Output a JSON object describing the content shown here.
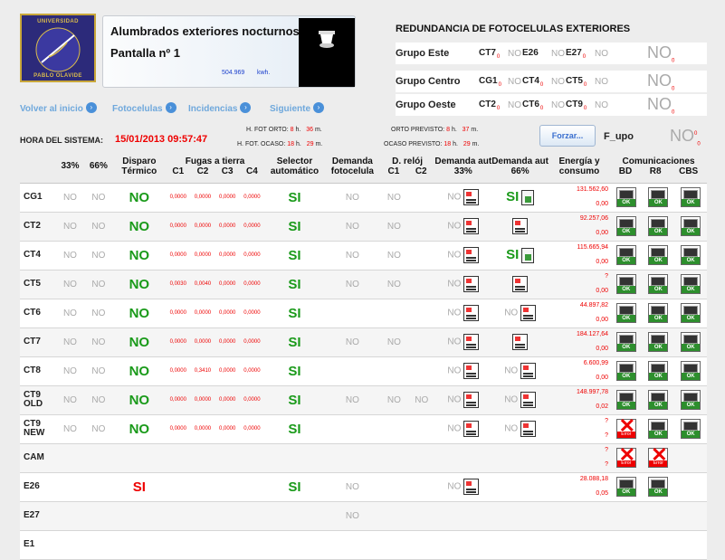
{
  "logo": {
    "line_top": "UNIVERSIDAD",
    "line_bottom": "PABLO OLAVIDE"
  },
  "header": {
    "title": "Alumbrados exteriores nocturnos",
    "subtitle": "Pantalla nº 1",
    "energy_value": "504.969",
    "energy_unit": "kwh."
  },
  "redundancy": {
    "title": "REDUNDANCIA DE FOTOCELULAS EXTERIORES",
    "groups": [
      {
        "name": "Grupo Este",
        "a": "CT7",
        "a_sub": "0",
        "a_val": "NO",
        "b": "E26",
        "b_val": "NO",
        "c": "E27",
        "c_sub": "0",
        "c_val": "NO",
        "big": "NO",
        "big_sub": "0"
      },
      {
        "name": "Grupo Centro",
        "a": "CG1",
        "a_sub": "0",
        "a_val": "NO",
        "b": "CT4",
        "b_sub": "0",
        "b_val": "NO",
        "c": "CT5",
        "c_sub": "0",
        "c_val": "NO",
        "big": "NO",
        "big_sub": "0"
      },
      {
        "name": "Grupo Oeste",
        "a": "CT2",
        "a_sub": "0",
        "a_val": "NO",
        "b": "CT6",
        "b_sub": "0",
        "b_val": "NO",
        "c": "CT9",
        "c_sub": "0",
        "c_val": "NO",
        "big": "NO",
        "big_sub": "0"
      }
    ]
  },
  "nav": {
    "home": "Volver al inicio",
    "photocells": "Fotocelulas",
    "incidents": "Incidencias",
    "next": "Siguiente"
  },
  "clock": {
    "label": "HORA DEL SISTEMA:",
    "value": "15/01/2013 09:57:47"
  },
  "fot": {
    "orto_label": "H. FOT ORTO:",
    "orto_h": "8",
    "orto_m": "36",
    "ocaso_label": "H. FOT. OCASO:",
    "ocaso_h": "18",
    "ocaso_m": "29",
    "orto_prev_label": "ORTO PREVISTO:",
    "orto_prev_h": "8",
    "orto_prev_m": "37",
    "ocaso_prev_label": "OCASO PREVISTO:",
    "ocaso_prev_h": "18",
    "ocaso_prev_m": "29",
    "h_unit": "h.",
    "m_unit": "m."
  },
  "force": {
    "button": "Forzar...",
    "label": "F_upo",
    "value": "NO",
    "sup": "0",
    "sub": "0"
  },
  "table": {
    "headers": {
      "p33": "33%",
      "p66": "66%",
      "disparo": "Disparo Térmico",
      "fugas": "Fugas a tierra",
      "c1": "C1",
      "c2": "C2",
      "c3": "C3",
      "c4": "C4",
      "selector": "Selector automático",
      "demanda": "Demanda fotocelula",
      "dreloj": "D. relój",
      "dc1": "C1",
      "dc2": "C2",
      "aut33": "Demanda aut 33%",
      "aut66": "Demanda aut 66%",
      "energia": "Energía y consumo",
      "comms": "Comunicaciones",
      "bd": "BD",
      "r8": "R8",
      "cbs": "CBS"
    },
    "rows": [
      {
        "name": "CG1",
        "p33": "NO",
        "p66": "NO",
        "disparo": "NO",
        "f": [
          "0,0000",
          "0,0000",
          "0,0000",
          "0,0000"
        ],
        "sel": "SI",
        "dem": "NO",
        "dc1": "NO",
        "dc2": "",
        "a33": "NO",
        "a33i": true,
        "a66": "SI",
        "a66i": "g",
        "e1": "131.562,60",
        "e2": "0,00",
        "bd": "ok",
        "r8": "ok",
        "cbs": "ok"
      },
      {
        "name": "CT2",
        "p33": "NO",
        "p66": "NO",
        "disparo": "NO",
        "f": [
          "0,0000",
          "0,0000",
          "0,0000",
          "0,0000"
        ],
        "sel": "SI",
        "dem": "NO",
        "dc1": "NO",
        "dc2": "",
        "a33": "NO",
        "a33i": true,
        "a66": "",
        "a66i": "d",
        "e1": "92.257,06",
        "e2": "0,00",
        "bd": "ok",
        "r8": "ok",
        "cbs": "ok"
      },
      {
        "name": "CT4",
        "p33": "NO",
        "p66": "NO",
        "disparo": "NO",
        "f": [
          "0,0000",
          "0,0000",
          "0,0000",
          "0,0000"
        ],
        "sel": "SI",
        "dem": "NO",
        "dc1": "NO",
        "dc2": "",
        "a33": "NO",
        "a33i": true,
        "a66": "SI",
        "a66i": "g",
        "e1": "115.665,94",
        "e2": "0,00",
        "bd": "ok",
        "r8": "ok",
        "cbs": "ok"
      },
      {
        "name": "CT5",
        "p33": "NO",
        "p66": "NO",
        "disparo": "NO",
        "f": [
          "0,0030",
          "0,0040",
          "0,0000",
          "0,0000"
        ],
        "sel": "SI",
        "dem": "NO",
        "dc1": "NO",
        "dc2": "",
        "a33": "NO",
        "a33i": true,
        "a66": "",
        "a66i": "d",
        "e1": "?",
        "e2": "0,00",
        "bd": "ok",
        "r8": "ok",
        "cbs": "ok"
      },
      {
        "name": "CT6",
        "p33": "NO",
        "p66": "NO",
        "disparo": "NO",
        "f": [
          "0,0000",
          "0,0000",
          "0,0000",
          "0,0000"
        ],
        "sel": "SI",
        "dem": "",
        "dc1": "",
        "dc2": "",
        "a33": "NO",
        "a33i": true,
        "a66": "NO",
        "a66i": "d",
        "e1": "44.897,82",
        "e2": "0,00",
        "bd": "ok",
        "r8": "ok",
        "cbs": "ok"
      },
      {
        "name": "CT7",
        "p33": "NO",
        "p66": "NO",
        "disparo": "NO",
        "f": [
          "0,0000",
          "0,0000",
          "0,0000",
          "0,0000"
        ],
        "sel": "SI",
        "dem": "NO",
        "dc1": "NO",
        "dc2": "",
        "a33": "NO",
        "a33i": true,
        "a66": "",
        "a66i": "d",
        "e1": "184.127,64",
        "e2": "0,00",
        "bd": "ok",
        "r8": "ok",
        "cbs": "ok"
      },
      {
        "name": "CT8",
        "p33": "NO",
        "p66": "NO",
        "disparo": "NO",
        "f": [
          "0,0000",
          "0,3410",
          "0,0000",
          "0,0000"
        ],
        "sel": "SI",
        "dem": "",
        "dc1": "",
        "dc2": "",
        "a33": "NO",
        "a33i": true,
        "a66": "NO",
        "a66i": "d",
        "e1": "6.600,99",
        "e2": "0,00",
        "bd": "ok",
        "r8": "ok",
        "cbs": "ok"
      },
      {
        "name": "CT9 OLD",
        "p33": "NO",
        "p66": "NO",
        "disparo": "NO",
        "f": [
          "0,0000",
          "0,0000",
          "0,0000",
          "0,0000"
        ],
        "sel": "SI",
        "dem": "NO",
        "dc1": "NO",
        "dc2": "NO",
        "a33": "NO",
        "a33i": true,
        "a66": "NO",
        "a66i": "d",
        "e1": "148.997,78",
        "e2": "0,02",
        "bd": "ok",
        "r8": "ok",
        "cbs": "ok"
      },
      {
        "name": "CT9 NEW",
        "p33": "NO",
        "p66": "NO",
        "disparo": "NO",
        "f": [
          "0,0000",
          "0,0000",
          "0,0000",
          "0,0000"
        ],
        "sel": "SI",
        "dem": "",
        "dc1": "",
        "dc2": "",
        "a33": "NO",
        "a33i": true,
        "a66": "NO",
        "a66i": "d",
        "e1": "?",
        "e2": "?",
        "bd": "err",
        "r8": "ok",
        "cbs": "ok"
      },
      {
        "name": "CAM",
        "p33": "",
        "p66": "",
        "disparo": "",
        "f": [
          "",
          "",
          "",
          ""
        ],
        "sel": "",
        "dem": "",
        "dc1": "",
        "dc2": "",
        "a33": "",
        "a33i": false,
        "a66": "",
        "a66i": "",
        "e1": "?",
        "e2": "?",
        "bd": "err",
        "r8": "err",
        "cbs": ""
      },
      {
        "name": "E26",
        "p33": "",
        "p66": "",
        "disparo": "SI",
        "f": [
          "",
          "",
          "",
          ""
        ],
        "sel": "SI",
        "dem": "NO",
        "dc1": "",
        "dc2": "",
        "a33": "NO",
        "a33i": true,
        "a66": "",
        "a66i": "",
        "e1": "28.088,18",
        "e2": "0,05",
        "bd": "ok",
        "r8": "ok",
        "cbs": ""
      },
      {
        "name": "E27",
        "p33": "",
        "p66": "",
        "disparo": "",
        "f": [
          "",
          "",
          "",
          ""
        ],
        "sel": "",
        "dem": "NO",
        "dc1": "",
        "dc2": "",
        "a33": "",
        "a33i": false,
        "a66": "",
        "a66i": "",
        "e1": "",
        "e2": "",
        "bd": "",
        "r8": "",
        "cbs": ""
      },
      {
        "name": "E1",
        "p33": "",
        "p66": "",
        "disparo": "",
        "f": [
          "",
          "",
          "",
          ""
        ],
        "sel": "",
        "dem": "",
        "dc1": "",
        "dc2": "",
        "a33": "",
        "a33i": false,
        "a66": "",
        "a66i": "",
        "e1": "",
        "e2": "",
        "bd": "",
        "r8": "",
        "cbs": ""
      }
    ],
    "ok_label": "OK",
    "err_label": "Error"
  },
  "colors": {
    "accent": "#6fa8dc",
    "ok": "#2d8f2d",
    "alert": "#e00000",
    "inactive": "#aaaaaa"
  }
}
